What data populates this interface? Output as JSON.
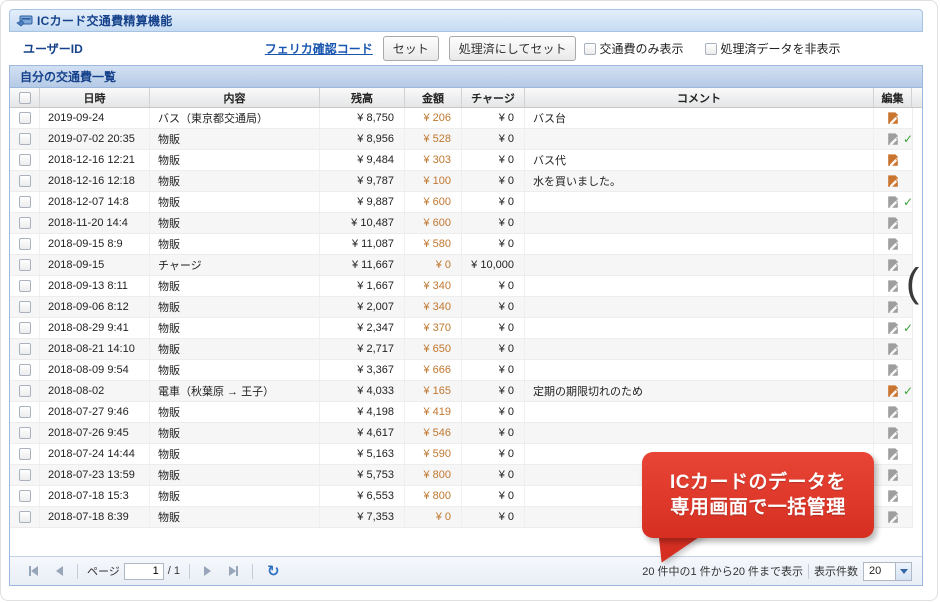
{
  "title": {
    "text": "ICカード交通費精算機能"
  },
  "toolbar": {
    "user_id_label": "ユーザーID",
    "felica_link": "フェリカ確認コード",
    "set_button": "セット",
    "set_processed_button": "処理済にしてセット",
    "filter_transport_only": "交通費のみ表示",
    "hide_processed": "処理済データを非表示"
  },
  "grid": {
    "section_title": "自分の交通費一覧",
    "columns": [
      "日時",
      "内容",
      "残高",
      "金額",
      "チャージ",
      "コメント",
      "編集"
    ],
    "rows": [
      {
        "datetime": "2019-09-24",
        "content": "バス（東京都交通局）",
        "balance": "¥ 8,750",
        "amount": "¥ 206",
        "charge": "¥ 0",
        "comment": "バス台",
        "edit": "orange",
        "checked": false
      },
      {
        "datetime": "2019-07-02 20:35",
        "content": "物販",
        "balance": "¥ 8,956",
        "amount": "¥ 528",
        "charge": "¥ 0",
        "comment": "",
        "edit": "gray",
        "checked": true
      },
      {
        "datetime": "2018-12-16 12:21",
        "content": "物販",
        "balance": "¥ 9,484",
        "amount": "¥ 303",
        "charge": "¥ 0",
        "comment": "バス代",
        "edit": "orange",
        "checked": false
      },
      {
        "datetime": "2018-12-16 12:18",
        "content": "物販",
        "balance": "¥ 9,787",
        "amount": "¥ 100",
        "charge": "¥ 0",
        "comment": "水を買いました。",
        "edit": "orange",
        "checked": false
      },
      {
        "datetime": "2018-12-07 14:8",
        "content": "物販",
        "balance": "¥ 9,887",
        "amount": "¥ 600",
        "charge": "¥ 0",
        "comment": "",
        "edit": "gray",
        "checked": true
      },
      {
        "datetime": "2018-11-20 14:4",
        "content": "物販",
        "balance": "¥ 10,487",
        "amount": "¥ 600",
        "charge": "¥ 0",
        "comment": "",
        "edit": "gray",
        "checked": false
      },
      {
        "datetime": "2018-09-15 8:9",
        "content": "物販",
        "balance": "¥ 11,087",
        "amount": "¥ 580",
        "charge": "¥ 0",
        "comment": "",
        "edit": "gray",
        "checked": false
      },
      {
        "datetime": "2018-09-15",
        "content": "チャージ",
        "balance": "¥ 11,667",
        "amount": "¥ 0",
        "charge": "¥ 10,000",
        "comment": "",
        "edit": "gray",
        "checked": false
      },
      {
        "datetime": "2018-09-13 8:11",
        "content": "物販",
        "balance": "¥ 1,667",
        "amount": "¥ 340",
        "charge": "¥ 0",
        "comment": "",
        "edit": "gray",
        "checked": false
      },
      {
        "datetime": "2018-09-06 8:12",
        "content": "物販",
        "balance": "¥ 2,007",
        "amount": "¥ 340",
        "charge": "¥ 0",
        "comment": "",
        "edit": "gray",
        "checked": false
      },
      {
        "datetime": "2018-08-29 9:41",
        "content": "物販",
        "balance": "¥ 2,347",
        "amount": "¥ 370",
        "charge": "¥ 0",
        "comment": "",
        "edit": "gray",
        "checked": true
      },
      {
        "datetime": "2018-08-21 14:10",
        "content": "物販",
        "balance": "¥ 2,717",
        "amount": "¥ 650",
        "charge": "¥ 0",
        "comment": "",
        "edit": "gray",
        "checked": false
      },
      {
        "datetime": "2018-08-09 9:54",
        "content": "物販",
        "balance": "¥ 3,367",
        "amount": "¥ 666",
        "charge": "¥ 0",
        "comment": "",
        "edit": "gray",
        "checked": false
      },
      {
        "datetime": "2018-08-02",
        "content": "電車（秋葉原 → 王子）",
        "balance": "¥ 4,033",
        "amount": "¥ 165",
        "charge": "¥ 0",
        "comment": "定期の期限切れのため",
        "edit": "orange",
        "checked": true
      },
      {
        "datetime": "2018-07-27 9:46",
        "content": "物販",
        "balance": "¥ 4,198",
        "amount": "¥ 419",
        "charge": "¥ 0",
        "comment": "",
        "edit": "gray",
        "checked": false
      },
      {
        "datetime": "2018-07-26 9:45",
        "content": "物販",
        "balance": "¥ 4,617",
        "amount": "¥ 546",
        "charge": "¥ 0",
        "comment": "",
        "edit": "gray",
        "checked": false
      },
      {
        "datetime": "2018-07-24 14:44",
        "content": "物販",
        "balance": "¥ 5,163",
        "amount": "¥ 590",
        "charge": "¥ 0",
        "comment": "",
        "edit": "gray",
        "checked": false
      },
      {
        "datetime": "2018-07-23 13:59",
        "content": "物販",
        "balance": "¥ 5,753",
        "amount": "¥ 800",
        "charge": "¥ 0",
        "comment": "",
        "edit": "gray",
        "checked": false
      },
      {
        "datetime": "2018-07-18 15:3",
        "content": "物販",
        "balance": "¥ 6,553",
        "amount": "¥ 800",
        "charge": "¥ 0",
        "comment": "",
        "edit": "gray",
        "checked": false
      },
      {
        "datetime": "2018-07-18 8:39",
        "content": "物販",
        "balance": "¥ 7,353",
        "amount": "¥ 0",
        "charge": "¥ 0",
        "comment": "",
        "edit": "gray",
        "checked": false
      }
    ]
  },
  "pager": {
    "page_label": "ページ",
    "page_value": "1",
    "page_total": "/ 1",
    "status": "20 件中の1 件から20 件まで表示",
    "page_size_label": "表示件数",
    "page_size_value": "20"
  },
  "callout": {
    "line1": "ICカードのデータを",
    "line2": "専用画面で一括管理"
  },
  "icons": {
    "app_icon": "ic-card-hand-icon",
    "refresh_glyph": "↻",
    "check_glyph": "✓"
  },
  "colors": {
    "edit_orange": "#c9742f",
    "edit_gray": "#9e9e9e",
    "check_green": "#3ca43c",
    "amount_orange": "#c0772f",
    "callout_red": "#d62f22",
    "navy": "#15428b"
  }
}
